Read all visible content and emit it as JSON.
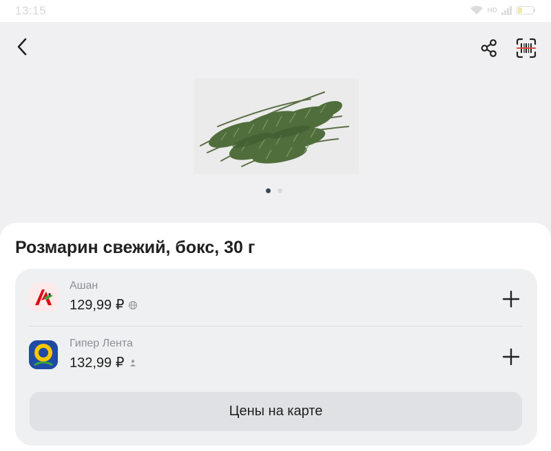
{
  "status_bar": {
    "time": "13:15",
    "network_label": "HD"
  },
  "header": {
    "image_indicator": {
      "count": 2,
      "active_index": 0
    }
  },
  "product": {
    "title": "Розмарин свежий, бокс, 30 г"
  },
  "offers": [
    {
      "store": "Ашан",
      "price": "129,99 ₽",
      "meta_icon": "globe-icon"
    },
    {
      "store": "Гипер Лента",
      "price": "132,99 ₽",
      "meta_icon": "person-icon"
    }
  ],
  "actions": {
    "map_button_label": "Цены на карте"
  },
  "colors": {
    "auchan_red": "#e30613",
    "lenta_blue": "#1f4aa6",
    "lenta_yellow": "#f7c600",
    "text_primary": "#21201f",
    "text_secondary": "#8b8e94"
  }
}
